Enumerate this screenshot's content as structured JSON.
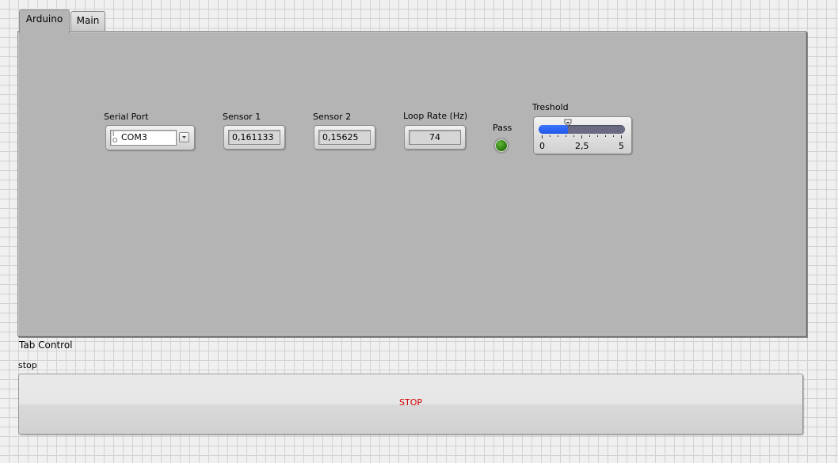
{
  "tabs": [
    {
      "label": "Arduino",
      "active": true
    },
    {
      "label": "Main",
      "active": false
    }
  ],
  "tab_control_label": "Tab Control",
  "serial_port": {
    "label": "Serial Port",
    "prefix_icon": "io-visa-icon",
    "value": "COM3"
  },
  "sensor1": {
    "label": "Sensor 1",
    "value": "0,161133"
  },
  "sensor2": {
    "label": "Sensor 2",
    "value": "0,15625"
  },
  "loop_rate": {
    "label": "Loop Rate (Hz)",
    "value": "74"
  },
  "pass": {
    "label": "Pass",
    "state": "on",
    "color": "#2f7d10"
  },
  "threshold": {
    "label": "Treshold",
    "min_label": "0",
    "mid_label": "2,5",
    "max_label": "5",
    "min": 0,
    "max": 5,
    "value": 1.7,
    "fill_color": "#1e56e6",
    "track_color": "#6a6a82"
  },
  "stop": {
    "label": "stop",
    "button_text": "STOP",
    "text_color": "#d10000"
  }
}
